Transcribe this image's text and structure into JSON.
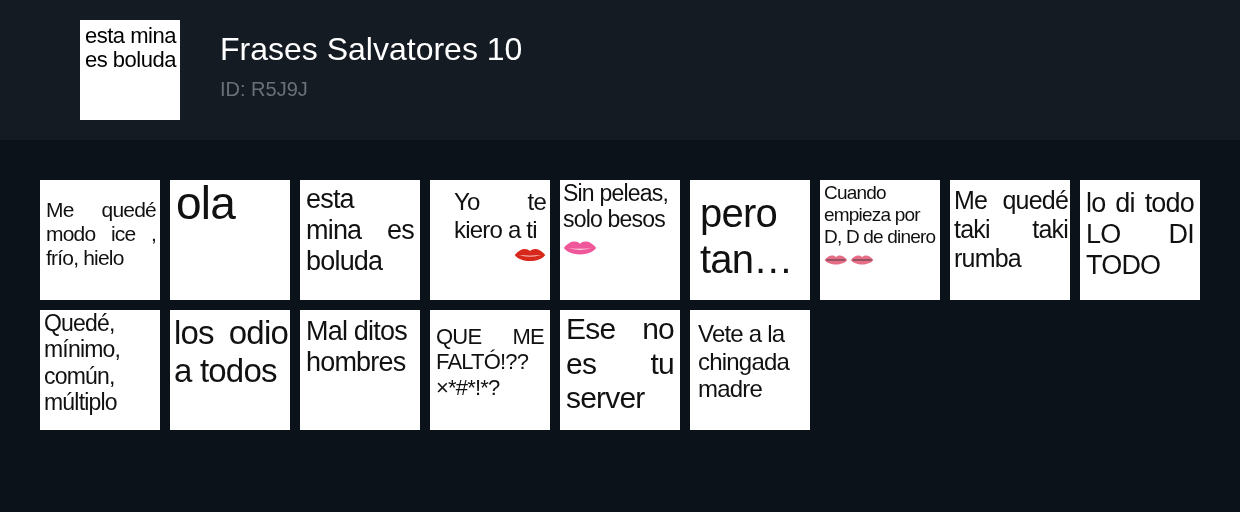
{
  "pack": {
    "thumbnail_text": "esta mina es boluda",
    "title": "Frases Salvatores 10",
    "id": "ID: R5J9J"
  },
  "stickers": [
    {
      "text": "Me quedé modo ice , frío, hielo",
      "kind": "plain"
    },
    {
      "text": "ola",
      "kind": "plain"
    },
    {
      "text": "esta mina es boluda",
      "kind": "plain"
    },
    {
      "text": "Yo te kiero a ti",
      "kind": "red-lips"
    },
    {
      "text": "Sin peleas, solo besos",
      "kind": "pink-lips"
    },
    {
      "text": "pero tan…",
      "kind": "plain"
    },
    {
      "text": "Cuando empieza por D, D de dinero",
      "kind": "double-lips"
    },
    {
      "text": "Me quedé taki taki rumba",
      "kind": "plain"
    },
    {
      "text": "lo di todo LO DI TODO",
      "kind": "plain"
    },
    {
      "text": "Quedé, mínimo, común, múltiplo",
      "kind": "plain"
    },
    {
      "text": "los odio a todos",
      "kind": "plain"
    },
    {
      "text": "Mal ditos hombres",
      "kind": "plain"
    },
    {
      "text": "QUE ME FALTÓ!?? ×*#*!*?",
      "kind": "plain"
    },
    {
      "text": "Ese no es tu server",
      "kind": "plain"
    },
    {
      "text": "Vete a la chingada madre",
      "kind": "plain"
    }
  ]
}
